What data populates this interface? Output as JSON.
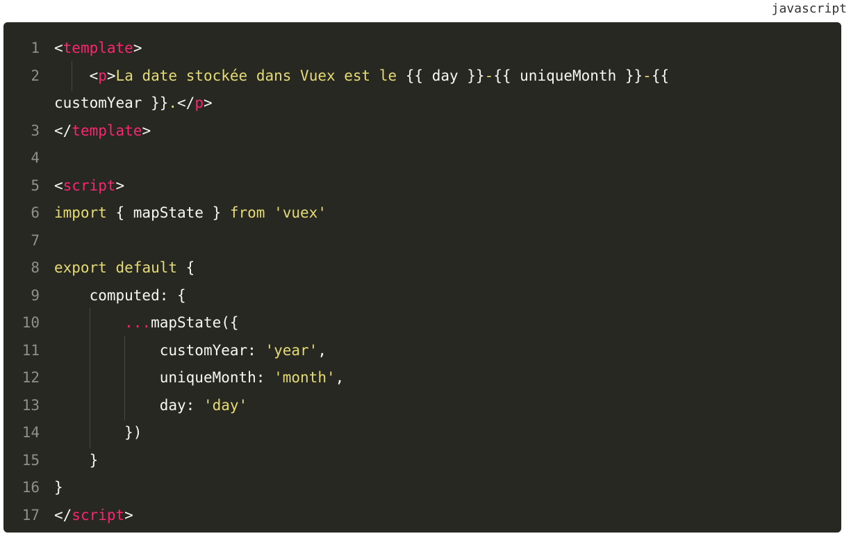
{
  "language_label": "javascript",
  "colors": {
    "background": "#272822",
    "line_number": "#8f908a",
    "tag": "#f92672",
    "string": "#e6db74",
    "plain": "#f8f8f2"
  },
  "lines": [
    {
      "n": "1",
      "indent": 0,
      "guides": 0,
      "tokens": [
        [
          "punct",
          "<"
        ],
        [
          "tag",
          "template"
        ],
        [
          "punct",
          ">"
        ]
      ]
    },
    {
      "n": "2",
      "indent": 4,
      "guides": 1,
      "tokens": [
        [
          "punct",
          "<"
        ],
        [
          "tag",
          "p"
        ],
        [
          "punct",
          ">"
        ],
        [
          "text",
          "La date stockée dans Vuex est le "
        ],
        [
          "plain",
          "{{ day }}"
        ],
        [
          "text",
          "-"
        ],
        [
          "plain",
          "{{ uniqueMonth }}"
        ],
        [
          "text",
          "-"
        ],
        [
          "plain",
          "{{"
        ]
      ]
    },
    {
      "n": "",
      "indent": 0,
      "guides": 0,
      "tokens": [
        [
          "plain",
          "customYear }}"
        ],
        [
          "text",
          "."
        ],
        [
          "punct",
          "</"
        ],
        [
          "tag",
          "p"
        ],
        [
          "punct",
          ">"
        ]
      ]
    },
    {
      "n": "3",
      "indent": 0,
      "guides": 0,
      "tokens": [
        [
          "punct",
          "</"
        ],
        [
          "tag",
          "template"
        ],
        [
          "punct",
          ">"
        ]
      ]
    },
    {
      "n": "4",
      "indent": 0,
      "guides": 0,
      "tokens": []
    },
    {
      "n": "5",
      "indent": 0,
      "guides": 0,
      "tokens": [
        [
          "punct",
          "<"
        ],
        [
          "tag",
          "script"
        ],
        [
          "punct",
          ">"
        ]
      ]
    },
    {
      "n": "6",
      "indent": 0,
      "guides": 0,
      "tokens": [
        [
          "kw",
          "import"
        ],
        [
          "plain",
          " { mapState } "
        ],
        [
          "kw",
          "from"
        ],
        [
          "plain",
          " "
        ],
        [
          "str",
          "'vuex'"
        ]
      ]
    },
    {
      "n": "7",
      "indent": 0,
      "guides": 0,
      "tokens": []
    },
    {
      "n": "8",
      "indent": 0,
      "guides": 0,
      "tokens": [
        [
          "kw",
          "export"
        ],
        [
          "plain",
          " "
        ],
        [
          "kw",
          "default"
        ],
        [
          "plain",
          " {"
        ]
      ]
    },
    {
      "n": "9",
      "indent": 4,
      "guides": 0,
      "tokens": [
        [
          "plain",
          "computed: {"
        ]
      ]
    },
    {
      "n": "10",
      "indent": 8,
      "guides": 1,
      "tokens": [
        [
          "spread",
          "..."
        ],
        [
          "plain",
          "mapState({"
        ]
      ]
    },
    {
      "n": "11",
      "indent": 12,
      "guides": 2,
      "tokens": [
        [
          "plain",
          "customYear: "
        ],
        [
          "str",
          "'year'"
        ],
        [
          "plain",
          ","
        ]
      ]
    },
    {
      "n": "12",
      "indent": 12,
      "guides": 2,
      "tokens": [
        [
          "plain",
          "uniqueMonth: "
        ],
        [
          "str",
          "'month'"
        ],
        [
          "plain",
          ","
        ]
      ]
    },
    {
      "n": "13",
      "indent": 12,
      "guides": 2,
      "tokens": [
        [
          "plain",
          "day: "
        ],
        [
          "str",
          "'day'"
        ]
      ]
    },
    {
      "n": "14",
      "indent": 8,
      "guides": 1,
      "tokens": [
        [
          "plain",
          "})"
        ]
      ]
    },
    {
      "n": "15",
      "indent": 4,
      "guides": 0,
      "tokens": [
        [
          "plain",
          "}"
        ]
      ]
    },
    {
      "n": "16",
      "indent": 0,
      "guides": 0,
      "tokens": [
        [
          "plain",
          "}"
        ]
      ]
    },
    {
      "n": "17",
      "indent": 0,
      "guides": 0,
      "tokens": [
        [
          "punct",
          "</"
        ],
        [
          "tag",
          "script"
        ],
        [
          "punct",
          ">"
        ]
      ]
    }
  ]
}
